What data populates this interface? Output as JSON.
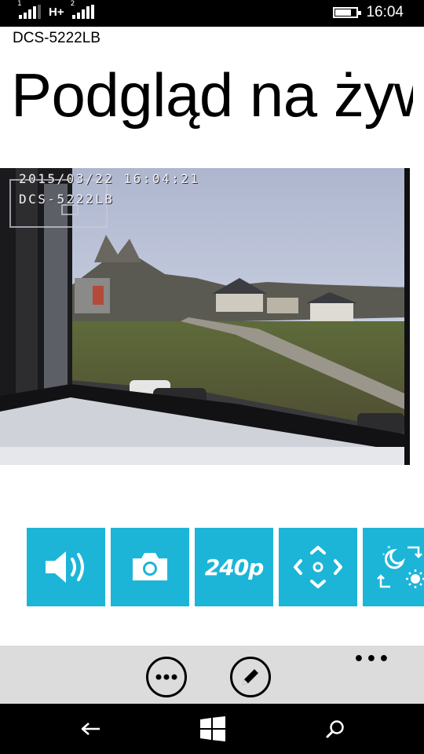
{
  "status_bar": {
    "network_type": "H+",
    "sim1_label": "1",
    "sim2_label": "2",
    "signal1_bars": 4,
    "signal2_bars": 4,
    "battery_level": 0.75,
    "time": "16:04"
  },
  "header": {
    "device_name": "DCS-5222LB",
    "page_title": "Podgląd na żywo"
  },
  "video": {
    "osd_timestamp": "2015/03/22 16:04:21",
    "osd_camera_name": "DCS-5222LB"
  },
  "controls": {
    "tiles": [
      {
        "name": "audio",
        "icon": "speaker-icon"
      },
      {
        "name": "snapshot",
        "icon": "camera-icon"
      },
      {
        "name": "resolution",
        "label": "240p"
      },
      {
        "name": "pan-tilt",
        "icon": "pan-tilt-arrows-icon"
      },
      {
        "name": "day-night",
        "icon": "day-night-icon"
      }
    ],
    "accent_color": "#1cb5d8"
  },
  "app_bar": {
    "buttons": [
      {
        "name": "more-options",
        "icon": "ellipsis-circle-icon"
      },
      {
        "name": "edit",
        "icon": "pencil-icon"
      }
    ],
    "overflow_label": "•••",
    "background": "#dcdcdc"
  },
  "nav_bar": {
    "items": [
      {
        "name": "back",
        "icon": "back-arrow-icon"
      },
      {
        "name": "start",
        "icon": "windows-logo-icon"
      },
      {
        "name": "search",
        "icon": "search-icon"
      }
    ]
  }
}
